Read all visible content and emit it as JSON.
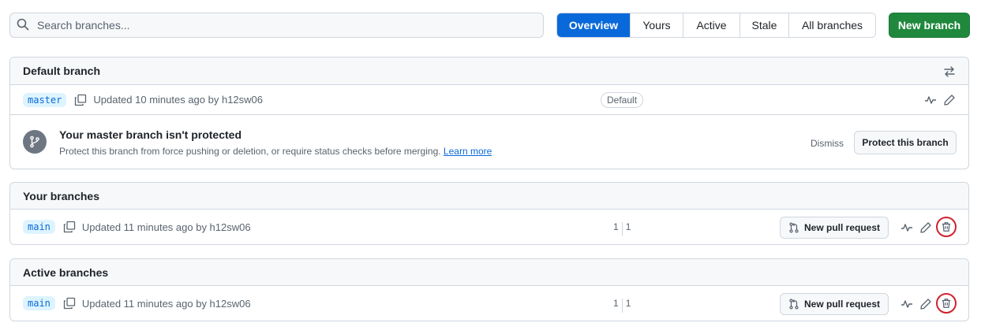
{
  "search": {
    "placeholder": "Search branches..."
  },
  "tabs": [
    {
      "label": "Overview",
      "active": true
    },
    {
      "label": "Yours",
      "active": false
    },
    {
      "label": "Active",
      "active": false
    },
    {
      "label": "Stale",
      "active": false
    },
    {
      "label": "All branches",
      "active": false
    }
  ],
  "new_branch_label": "New branch",
  "default_section": {
    "title": "Default branch",
    "branch": "master",
    "updated": "Updated 10 minutes ago by h12sw06",
    "badge": "Default",
    "notice": {
      "title": "Your master branch isn't protected",
      "description": "Protect this branch from force pushing or deletion, or require status checks before merging.",
      "link": "Learn more",
      "dismiss": "Dismiss",
      "protect_button": "Protect this branch"
    }
  },
  "your_section": {
    "title": "Your branches",
    "branch": "main",
    "updated": "Updated 11 minutes ago by h12sw06",
    "behind": "1",
    "ahead": "1",
    "pr_button": "New pull request"
  },
  "active_section": {
    "title": "Active branches",
    "branch": "main",
    "updated": "Updated 11 minutes ago by h12sw06",
    "behind": "1",
    "ahead": "1",
    "pr_button": "New pull request"
  },
  "colors": {
    "accent": "#0969da",
    "primary_button": "#1f883d",
    "danger_highlight": "#cf222e"
  }
}
